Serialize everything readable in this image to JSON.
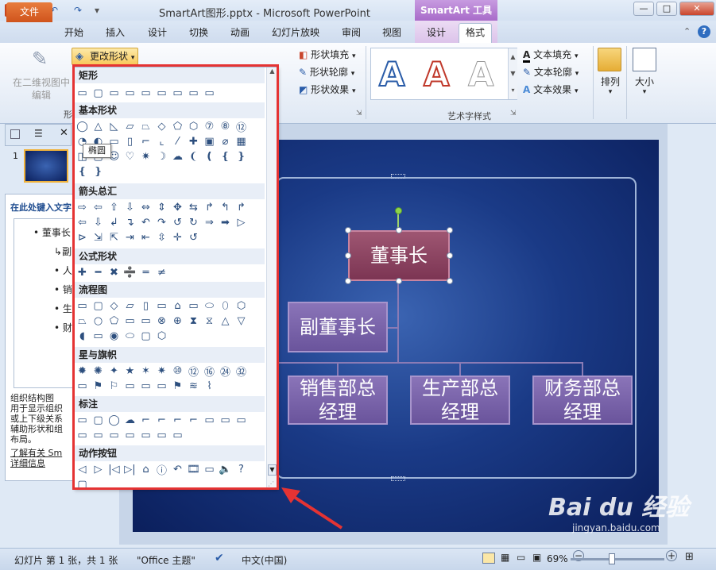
{
  "window": {
    "title": "SmartArt图形.pptx - Microsoft PowerPoint",
    "context_tool": "SmartArt 工具",
    "min": "—",
    "max": "□",
    "close": "✕"
  },
  "tabs": {
    "file": "文件",
    "items": [
      "开始",
      "插入",
      "设计",
      "切换",
      "动画",
      "幻灯片放映",
      "审阅",
      "视图"
    ],
    "context_design": "设计",
    "context_format": "格式"
  },
  "ribbon": {
    "edit_2d_line1": "在二维视图中",
    "edit_2d_line2": "编辑",
    "change_shape": "更改形状",
    "shape_fill": "形状填充",
    "shape_outline": "形状轮廓",
    "shape_effects": "形状效果",
    "text_fill": "文本填充",
    "text_outline": "文本轮廓",
    "text_effects": "文本效果",
    "wordart_group": "艺术字样式",
    "shapes_group_partial": "形",
    "arrange": "排列",
    "size": "大小"
  },
  "dropdown": {
    "categories": [
      "矩形",
      "基本形状",
      "箭头总汇",
      "公式形状",
      "流程图",
      "星与旗帜",
      "标注",
      "动作按钮"
    ],
    "tooltip": "椭圆"
  },
  "text_pane": {
    "header": "在此处键入文字",
    "bullet1": "董事长",
    "sub1": "副",
    "bullets": [
      "人",
      "销",
      "生",
      "财"
    ],
    "desc_title": "组织结构图",
    "desc_line1": "用于显示组织",
    "desc_line2": "或上下级关系",
    "desc_line3": "辅助形状和组",
    "desc_line4": "布局。",
    "learn_more": "了解有关 Sm",
    "details": "详细信息"
  },
  "slide_panel": {
    "slide_number": "1"
  },
  "org_chart": {
    "ceo": "董事长",
    "vice": "副董事长",
    "sales": "销售部总经理",
    "production": "生产部总经理",
    "finance": "财务部总经理"
  },
  "status": {
    "slide_info": "幻灯片 第 1 张，共 1 张",
    "theme": "\"Office 主题\"",
    "language": "中文(中国)",
    "zoom": "69%",
    "minus": "−",
    "plus": "+"
  },
  "watermark": {
    "brand": "Bai du 经验",
    "url": "jingyan.baidu.com"
  },
  "colors": {
    "accent_red": "#e53333",
    "file_tab": "#d0541c",
    "context_purple": "#a86bc9"
  }
}
